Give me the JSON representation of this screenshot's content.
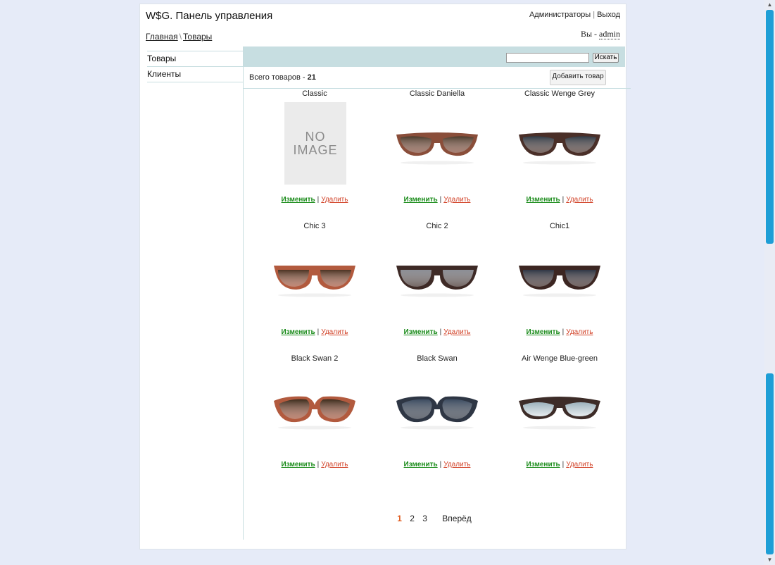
{
  "header": {
    "title": "W$G. Панель управления",
    "links": [
      "Администраторы",
      "Выход"
    ],
    "breadcrumb": [
      "Главная",
      "Товары"
    ],
    "user_prefix": "Вы - ",
    "user_name": "admin"
  },
  "sidebar": {
    "items": [
      {
        "label": "Товары"
      },
      {
        "label": "Клиенты"
      }
    ]
  },
  "search": {
    "value": "",
    "placeholder": "",
    "button": "Искать"
  },
  "summary": {
    "label": "Всего товаров - ",
    "count": "21",
    "add_button": "Добавить товар"
  },
  "actions": {
    "edit": "Изменить",
    "delete": "Удалить",
    "separator": "|"
  },
  "products": [
    {
      "name": "Classic",
      "image": "no-image",
      "noimage_text": [
        "NO",
        "IMAGE"
      ]
    },
    {
      "name": "Classic Daniella",
      "image": "sunglasses-brown-wood"
    },
    {
      "name": "Classic Wenge Grey",
      "image": "sunglasses-wenge-grey"
    },
    {
      "name": "Chic 3",
      "image": "sunglasses-chic-red-wood"
    },
    {
      "name": "Chic 2",
      "image": "sunglasses-chic-grey"
    },
    {
      "name": "Chic1",
      "image": "sunglasses-chic-dark"
    },
    {
      "name": "Black Swan 2",
      "image": "sunglasses-swan-brown"
    },
    {
      "name": "Black Swan",
      "image": "sunglasses-swan-blue"
    },
    {
      "name": "Air Wenge Blue-green",
      "image": "sunglasses-aviator-bluegreen"
    }
  ],
  "pagination": {
    "pages": [
      "1",
      "2",
      "3"
    ],
    "current": "1",
    "next": "Вперёд"
  },
  "colors": {
    "background": "#e6ebf8",
    "panel_bar": "#c7dee1",
    "edit_link": "#1b8c1b",
    "delete_link": "#d2442a",
    "active_page": "#e05a1c",
    "scrollbar_thumb": "#1e9ed6"
  }
}
